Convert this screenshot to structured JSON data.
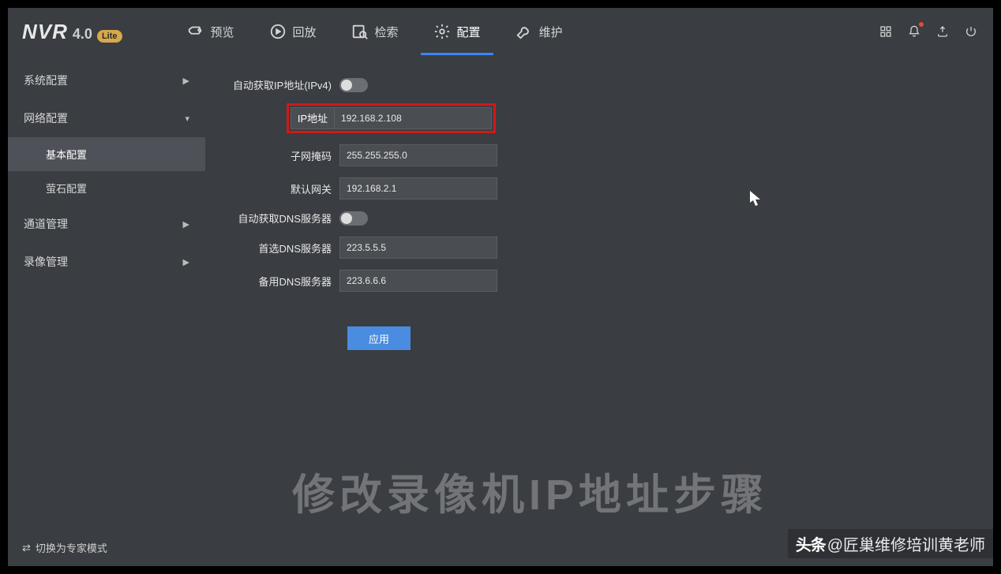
{
  "logo": {
    "name": "NVR",
    "version": "4.0",
    "badge": "Lite"
  },
  "tabs": {
    "preview": "预览",
    "playback": "回放",
    "search": "检索",
    "config": "配置",
    "maintain": "维护"
  },
  "sidebar": {
    "system": "系统配置",
    "network": "网络配置",
    "basic": "基本配置",
    "cloud": "萤石配置",
    "channel": "通道管理",
    "record": "录像管理"
  },
  "form": {
    "auto_ipv4": "自动获取IP地址(IPv4)",
    "ip_label": "IP地址",
    "ip_value": "192.168.2.108",
    "mask_label": "子网掩码",
    "mask_value": "255.255.255.0",
    "gateway_label": "默认网关",
    "gateway_value": "192.168.2.1",
    "auto_dns": "自动获取DNS服务器",
    "dns1_label": "首选DNS服务器",
    "dns1_value": "223.5.5.5",
    "dns2_label": "备用DNS服务器",
    "dns2_value": "223.6.6.6",
    "apply": "应用"
  },
  "footer": {
    "mode": "切换为专家模式"
  },
  "overlay": {
    "title": "修改录像机IP地址步骤",
    "attr_logo": "头条",
    "attr_handle": "@匠巢维修培训黄老师"
  }
}
